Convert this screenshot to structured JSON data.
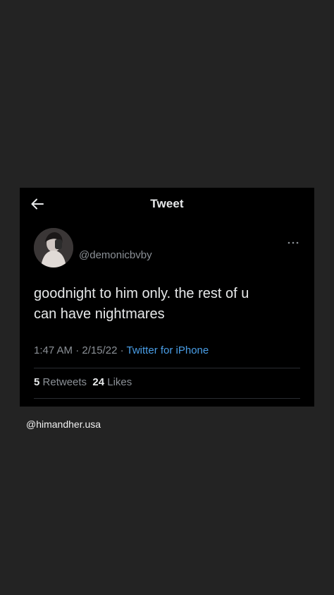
{
  "header": {
    "title": "Tweet",
    "back_icon": "arrow-left-icon"
  },
  "tweet": {
    "handle": "@demonicbvby",
    "text_line1": "goodnight to him only. the rest of u",
    "text_line2": "can have nightmares",
    "time": "1:47 AM",
    "date": "2/15/22",
    "separator": "·",
    "source": "Twitter for iPhone",
    "retweets_count": "5",
    "retweets_label": "Retweets",
    "likes_count": "24",
    "likes_label": "Likes",
    "more_icon": "more-dots-icon"
  },
  "watermark": "@himandher.usa",
  "colors": {
    "page_background": "#232323",
    "card_background": "#000000",
    "text_primary": "#e7e9ea",
    "text_secondary": "#8b9096",
    "link": "#4a9fe8"
  }
}
